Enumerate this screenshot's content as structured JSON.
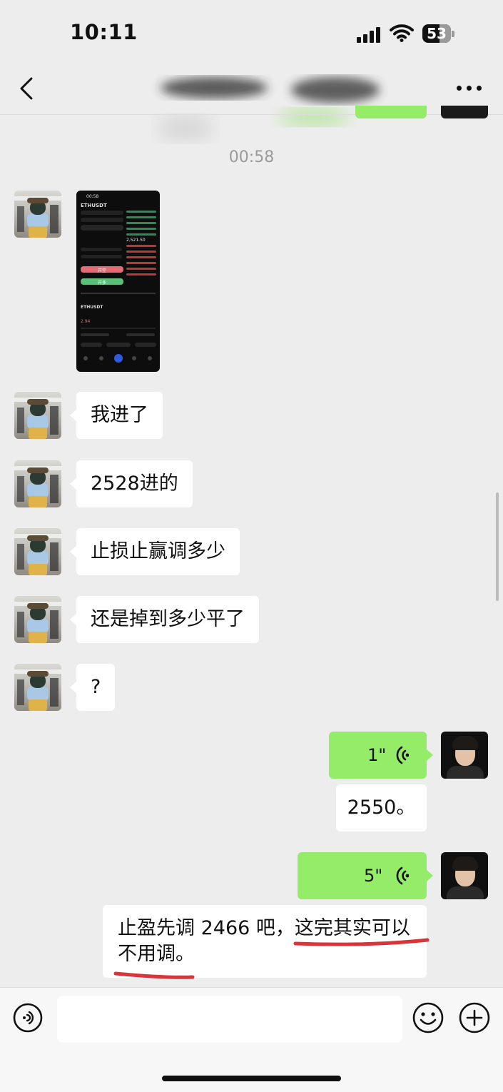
{
  "status_bar": {
    "time": "10:11",
    "battery": "53"
  },
  "chat": {
    "timestamp": "00:58",
    "incoming_messages": [
      {
        "text": "我进了"
      },
      {
        "text": "2528进的"
      },
      {
        "text": "止损止赢调多少"
      },
      {
        "text": "还是掉到多少平了"
      },
      {
        "text": "?"
      }
    ],
    "outgoing": {
      "voice_1_duration": "1\"",
      "text_1": "2550。",
      "voice_2_duration": "5\"",
      "text_2_line1": "止盈先调 2466 吧，这完其实可以",
      "text_2_line2": "不用调。"
    }
  },
  "screenshot_thumb": {
    "time": "00:58",
    "symbol": "ETHUSDT",
    "price": "2,521.50",
    "pair_label": "ETHUSDT",
    "buy_label": "开多",
    "sell_label": "开空",
    "pnl": "2.94"
  },
  "colors": {
    "accent_green": "#95ec69",
    "annotation_red": "#d8343b"
  }
}
